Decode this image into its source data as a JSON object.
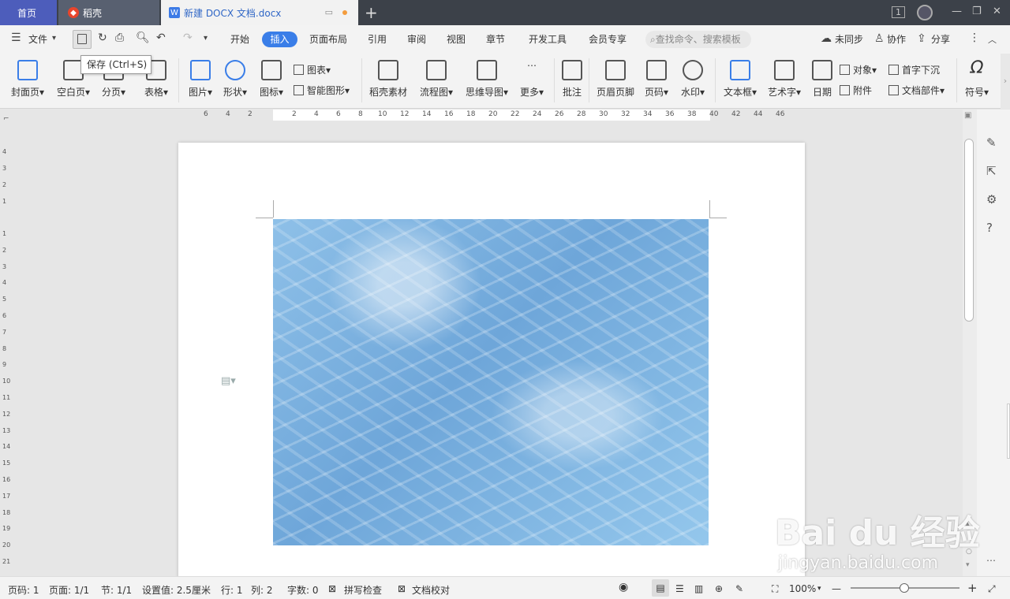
{
  "tabs": {
    "home": "首页",
    "daoke": "稻壳",
    "doc": "新建 DOCX 文档.docx",
    "new_tab": "+"
  },
  "window": {
    "badge": "1",
    "minimize": "—",
    "restore": "❐",
    "close": "✕"
  },
  "cmdbar": {
    "menu_icon": "☰",
    "file": "文件",
    "menu_tabs": [
      "开始",
      "插入",
      "页面布局",
      "引用",
      "审阅",
      "视图",
      "章节",
      "开发工具",
      "会员专享"
    ],
    "search_placeholder": "查找命令、搜索模板",
    "sync": "未同步",
    "collab": "协作",
    "share": "分享"
  },
  "tooltip": "保存 (Ctrl+S)",
  "ribbon": {
    "cover": "封面页",
    "blank": "空白页",
    "pagebreak": "分页",
    "table": "表格",
    "picture": "图片",
    "shape": "形状",
    "icon": "图标",
    "chart": "图表",
    "smartart": "智能图形",
    "daoke_material": "稻壳素材",
    "flowchart": "流程图",
    "mindmap": "思维导图",
    "more": "更多",
    "comment": "批注",
    "header_footer": "页眉页脚",
    "page_number": "页码",
    "watermark": "水印",
    "textbox": "文本框",
    "wordart": "艺术字",
    "date": "日期",
    "object": "对象",
    "attachment": "附件",
    "dropcap": "首字下沉",
    "doc_parts": "文档部件",
    "symbol": "符号"
  },
  "ruler_h": [
    "6",
    "4",
    "2",
    "2",
    "4",
    "6",
    "8",
    "10",
    "12",
    "14",
    "16",
    "18",
    "20",
    "22",
    "24",
    "26",
    "28",
    "30",
    "32",
    "34",
    "36",
    "38",
    "40",
    "42",
    "44",
    "46"
  ],
  "ruler_v": [
    "4",
    "3",
    "2",
    "1",
    "1",
    "2",
    "3",
    "4",
    "5",
    "6",
    "7",
    "8",
    "9",
    "10",
    "11",
    "12",
    "13",
    "14",
    "15",
    "16",
    "17",
    "18",
    "19",
    "20",
    "21"
  ],
  "status": {
    "page_num": "页码: 1",
    "pages": "页面: 1/1",
    "section": "节: 1/1",
    "setting": "设置值: 2.5厘米",
    "row": "行: 1",
    "col": "列: 2",
    "words": "字数: 0",
    "spellcheck": "拼写检查",
    "proofread": "文档校对",
    "zoom": "100%",
    "zoom_minus": "—",
    "zoom_plus": "+"
  },
  "watermark": {
    "brand": "Bai du 经验",
    "url": "jingyan.baidu.com"
  }
}
